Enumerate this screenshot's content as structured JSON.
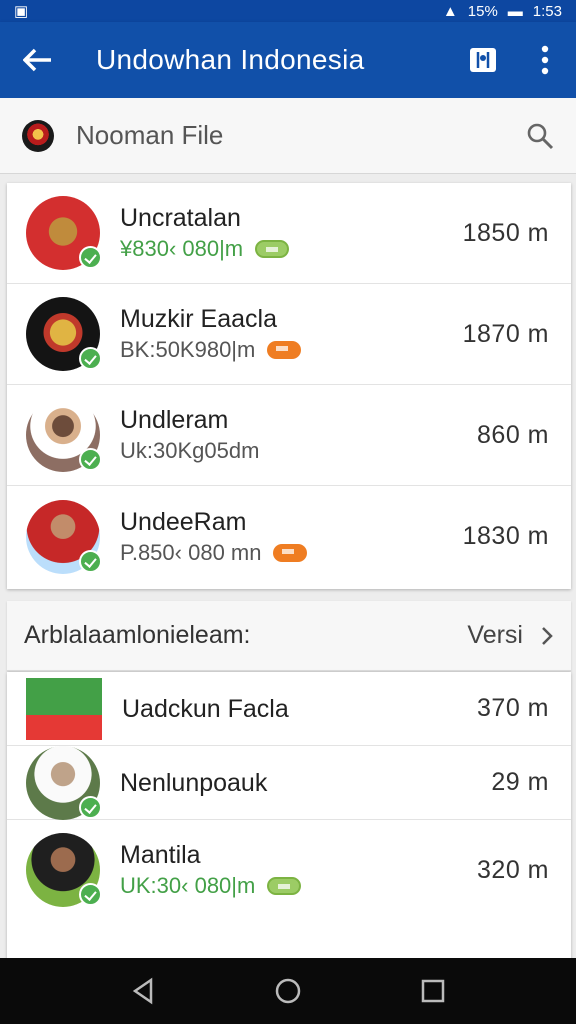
{
  "status": {
    "battery": "15%",
    "time": "1:53"
  },
  "header": {
    "title": "Undowhan Indonesia"
  },
  "search": {
    "placeholder": "Nooman File"
  },
  "list1": [
    {
      "name": "Uncratalan",
      "detail": "¥830‹ 080|m",
      "distance": "1850 m",
      "tag": "green"
    },
    {
      "name": "Muzkir Eaacla",
      "detail": "BK:50K980|m",
      "distance": "1870 m",
      "tag": "orange"
    },
    {
      "name": "Undleram",
      "detail": "Uk:30Kg05dm",
      "distance": "860 m",
      "tag": ""
    },
    {
      "name": "UndeeRam",
      "detail": "P.850‹ 080 mn",
      "distance": "1830 m",
      "tag": "orange"
    }
  ],
  "section": {
    "title": "Arblalaamlonieleam:",
    "link": "Versi"
  },
  "list2": [
    {
      "name": "Uadckun Facla",
      "detail": "",
      "distance": "370 m"
    },
    {
      "name": "Nenlunpoauk",
      "detail": "",
      "distance": "29 m"
    },
    {
      "name": "Mantila",
      "detail": "UK:30‹ 080|m",
      "distance": "320 m"
    }
  ]
}
